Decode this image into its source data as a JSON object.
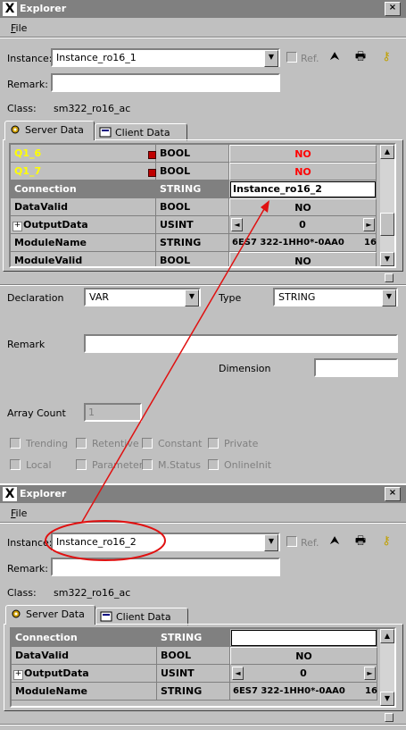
{
  "window1": {
    "title": "Explorer",
    "close": "×",
    "menu_file": "File",
    "instance_label": "Instance:",
    "instance_value": "Instance_ro16_1",
    "ref_label": "Ref.",
    "remark_label": "Remark:",
    "class_label": "Class:",
    "class_value": "sm322_ro16_ac",
    "tab_server": "Server Data",
    "tab_client": "Client Data",
    "rows": [
      {
        "name": "Q1_6",
        "type": "BOOL",
        "value": "NO"
      },
      {
        "name": "Q1_7",
        "type": "BOOL",
        "value": "NO"
      },
      {
        "name": "Connection",
        "type": "STRING",
        "value": "Instance_ro16_2"
      },
      {
        "name": "DataValid",
        "type": "BOOL",
        "value": "NO"
      },
      {
        "name": "OutputData",
        "type": "USINT",
        "value": "0"
      },
      {
        "name": "ModuleName",
        "type": "STRING",
        "value": "6ES7 322-1HH0*-0AA0",
        "extra": "16"
      },
      {
        "name": "ModuleValid",
        "type": "BOOL",
        "value": "NO"
      }
    ],
    "declaration_label": "Declaration",
    "declaration_value": "VAR",
    "type_label": "Type",
    "type_value": "STRING",
    "remark2_label": "Remark",
    "dimension_label": "Dimension",
    "array_count_label": "Array Count",
    "array_count_value": "1",
    "checkboxes": [
      "Trending",
      "Retentive",
      "Constant",
      "Private",
      "Local",
      "Parameter",
      "M.Status",
      "OnlineInit"
    ]
  },
  "window2": {
    "title": "Explorer",
    "close": "×",
    "menu_file": "File",
    "instance_label": "Instance:",
    "instance_value": "Instance_ro16_2",
    "ref_label": "Ref.",
    "remark_label": "Remark:",
    "class_label": "Class:",
    "class_value": "sm322_ro16_ac",
    "tab_server": "Server Data",
    "tab_client": "Client Data",
    "rows": [
      {
        "name": "Connection",
        "type": "STRING",
        "value": ""
      },
      {
        "name": "DataValid",
        "type": "BOOL",
        "value": "NO"
      },
      {
        "name": "OutputData",
        "type": "USINT",
        "value": "0"
      },
      {
        "name": "ModuleName",
        "type": "STRING",
        "value": "6ES7 322-1HH0*-0AA0",
        "extra": "16"
      }
    ]
  },
  "icons": {
    "up": "⮝",
    "print": "🖶",
    "key": "⚷",
    "dropdown": "▼",
    "scroll_up": "▲",
    "scroll_down": "▼",
    "spin_left": "◄",
    "spin_right": "►",
    "plus": "+"
  },
  "colors": {
    "annotation": "#e01010",
    "highlight": "#ffff00"
  }
}
